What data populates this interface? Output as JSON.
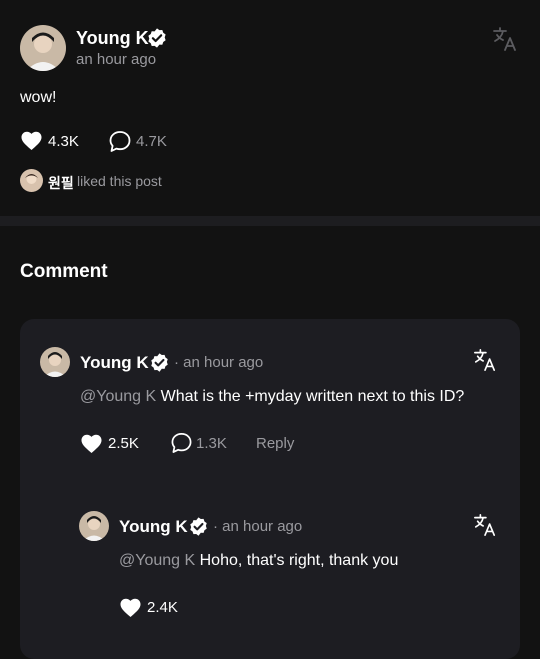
{
  "post": {
    "author": "Young K",
    "time": "an hour ago",
    "text": "wow!",
    "likes": "4.3K",
    "comments": "4.7K",
    "liker_name": "원필",
    "liked_text": "liked this post"
  },
  "comments_section": {
    "title": "Comment",
    "items": [
      {
        "author": "Young K",
        "time": "· an hour ago",
        "mention": "@Young K",
        "text": "What is the +myday written next to this ID?",
        "likes": "2.5K",
        "replies_count": "1.3K",
        "reply_label": "Reply",
        "reply": {
          "author": "Young K",
          "time": "· an hour ago",
          "mention": "@Young K",
          "text": "Hoho, that's right, thank you",
          "likes": "2.4K"
        }
      }
    ]
  },
  "icons": {
    "verified": "verified-badge-icon",
    "heart": "heart-icon",
    "comment": "comment-bubble-icon",
    "translate": "translate-icon"
  },
  "colors": {
    "background": "#121212",
    "card": "#1d1d22",
    "text": "#ffffff",
    "muted": "#9a9a9f"
  }
}
